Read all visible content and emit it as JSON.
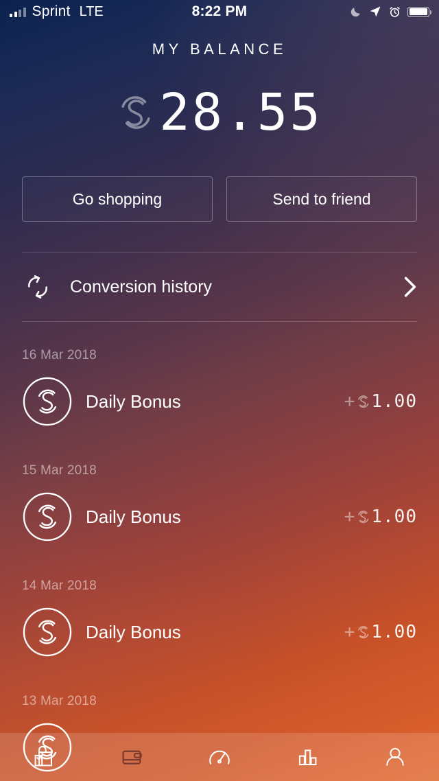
{
  "status_bar": {
    "carrier": "Sprint",
    "network": "LTE",
    "time": "8:22 PM",
    "icons": [
      "signal-bars-icon",
      "moon-icon",
      "location-arrow-icon",
      "alarm-clock-icon",
      "battery-icon"
    ]
  },
  "header": {
    "title": "MY BALANCE",
    "currency_symbol": "sweatcoin-symbol",
    "balance": "28.55"
  },
  "actions": {
    "go_shopping": "Go shopping",
    "send_to_friend": "Send to friend"
  },
  "conversion_history": {
    "label": "Conversion history",
    "icon": "sync-arrows-icon",
    "chevron": "chevron-right-icon"
  },
  "transactions": [
    {
      "date": "16 Mar 2018",
      "name": "Daily Bonus",
      "sign": "+",
      "value": "1.00"
    },
    {
      "date": "15 Mar 2018",
      "name": "Daily Bonus",
      "sign": "+",
      "value": "1.00"
    },
    {
      "date": "14 Mar 2018",
      "name": "Daily Bonus",
      "sign": "+",
      "value": "1.00"
    },
    {
      "date": "13 Mar 2018",
      "name": "",
      "sign": "",
      "value": ""
    }
  ],
  "tabbar": {
    "items": [
      {
        "name": "tab-shop",
        "icon": "shopping-bag-icon",
        "active": false
      },
      {
        "name": "tab-wallet",
        "icon": "wallet-icon",
        "active": true
      },
      {
        "name": "tab-activity",
        "icon": "speedometer-icon",
        "active": false
      },
      {
        "name": "tab-stats",
        "icon": "bar-chart-icon",
        "active": false
      },
      {
        "name": "tab-profile",
        "icon": "person-icon",
        "active": false
      }
    ]
  },
  "colors": {
    "gradient_start": "#0c2250",
    "gradient_mid": "#783e45",
    "gradient_end": "#e0692f",
    "text": "#ffffff",
    "tab_active": "#7a3a2c"
  }
}
